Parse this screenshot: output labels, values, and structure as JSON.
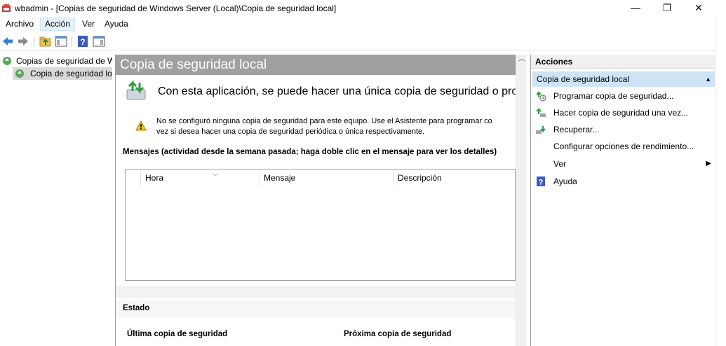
{
  "window": {
    "title": "wbadmin - [Copias de seguridad de Windows Server (Local)\\Copia de seguridad local]",
    "minimize": "—",
    "maximize": "❐",
    "close": "✕"
  },
  "menu": {
    "items": [
      {
        "label": "Archivo"
      },
      {
        "label": "Acción"
      },
      {
        "label": "Ver"
      },
      {
        "label": "Ayuda"
      }
    ]
  },
  "toolbar": {
    "icons": [
      "back-arrow-icon",
      "forward-arrow-icon",
      "up-folder-icon",
      "show-hide-tree-icon",
      "help-icon",
      "show-hide-action-pane-icon"
    ]
  },
  "tree": {
    "root_label": "Copias de seguridad de W",
    "child_label": "Copia de seguridad loc"
  },
  "center": {
    "header": "Copia de seguridad local",
    "intro": "Con esta aplicación, se puede hacer una única copia de seguridad o progra",
    "warning_line1": "No se configuró ninguna copia de seguridad para este equipo. Use el Asistente para programar co",
    "warning_line2": "vez si desea hacer una copia de seguridad periódica o única respectivamente.",
    "messages_title": "Mensajes (actividad desde la semana pasada; haga doble clic en el mensaje para ver los detalles)",
    "columns": [
      "Hora",
      "Mensaje",
      "Descripción"
    ],
    "status_title": "Estado",
    "last_backup": "Última copia de seguridad",
    "next_backup": "Próxima copia de seguridad"
  },
  "actions": {
    "title": "Acciones",
    "group": "Copia de seguridad local",
    "items": [
      {
        "label": "Programar copia de seguridad...",
        "icon": "schedule-backup-icon"
      },
      {
        "label": "Hacer copia de seguridad una vez...",
        "icon": "backup-once-icon"
      },
      {
        "label": "Recuperar...",
        "icon": "recover-icon"
      },
      {
        "label": "Configurar opciones de rendimiento...",
        "icon": ""
      },
      {
        "label": "Ver",
        "icon": ""
      },
      {
        "label": "Ayuda",
        "icon": "help-icon"
      }
    ]
  },
  "colors": {
    "header_gray": "#a0a0a0",
    "selection_blue": "#cde3f7",
    "menu_hover": "#e5f1fb"
  }
}
